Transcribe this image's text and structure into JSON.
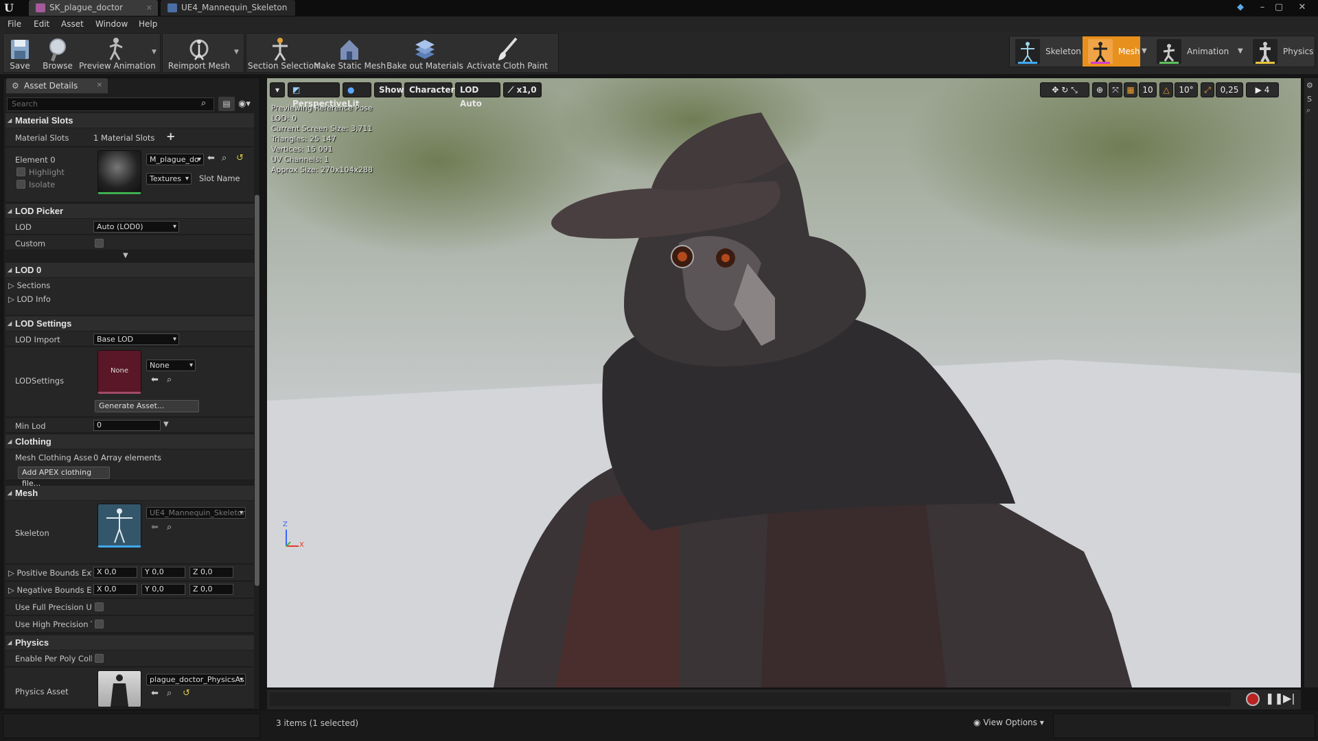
{
  "titlebar": {
    "tabs": [
      {
        "label": "SK_plague_doctor"
      },
      {
        "label": "UE4_Mannequin_Skeleton"
      }
    ],
    "minimize": "–",
    "maximize": "▢",
    "close": "✕"
  },
  "menu": [
    "File",
    "Edit",
    "Asset",
    "Window",
    "Help"
  ],
  "toolbar": {
    "save": "Save",
    "browse": "Browse",
    "preview_animation": "Preview Animation",
    "reimport_mesh": "Reimport Mesh",
    "section_selection": "Section Selection",
    "make_static_mesh": "Make Static Mesh",
    "bake_out_materials": "Bake out Materials",
    "activate_cloth_paint": "Activate Cloth Paint"
  },
  "modes": {
    "skeleton": "Skeleton",
    "mesh": "Mesh",
    "animation": "Animation",
    "physics": "Physics",
    "active": "Mesh",
    "active_color": "#e8901e"
  },
  "details": {
    "tab": "Asset Details",
    "search_placeholder": "Search",
    "material_slots": {
      "header": "Material Slots",
      "label": "Material Slots",
      "count": "1 Material Slots",
      "element": "Element 0",
      "highlight": "Highlight",
      "isolate": "Isolate",
      "material": "M_plague_do",
      "textures": "Textures",
      "slot_name": "Slot Name"
    },
    "lod_picker": {
      "header": "LOD Picker",
      "lod_label": "LOD",
      "lod_value": "Auto (LOD0)",
      "custom": "Custom"
    },
    "lod0": {
      "header": "LOD 0",
      "sections": "Sections",
      "lod_info": "LOD Info"
    },
    "lod_settings": {
      "header": "LOD Settings",
      "lod_import": "LOD Import",
      "lod_import_value": "Base LOD",
      "lodsettings": "LODSettings",
      "thumb_none": "None",
      "none_combo": "None",
      "generate": "Generate Asset...",
      "min_lod": "Min Lod",
      "min_lod_value": "0"
    },
    "clothing": {
      "header": "Clothing",
      "label": "Mesh Clothing Asset",
      "value": "0 Array elements",
      "add_btn": "Add APEX clothing file..."
    },
    "mesh": {
      "header": "Mesh",
      "skeleton": "Skeleton",
      "skeleton_value": "UE4_Mannequin_Skeleton",
      "pos_bounds": "Positive Bounds Exte",
      "neg_bounds": "Negative Bounds Exte",
      "x": "X",
      "y": "Y",
      "z": "Z",
      "zero": "0,0",
      "full_uv": "Use Full Precision UV",
      "high_tan": "Use High Precision Ta"
    },
    "physics": {
      "header": "Physics",
      "per_poly": "Enable Per Poly Collis",
      "physics_asset": "Physics Asset",
      "physics_asset_value": "plague_doctor_PhysicsAs"
    }
  },
  "viewport": {
    "perspective": "Perspective",
    "lit": "Lit",
    "show": "Show",
    "character": "Character",
    "lod_auto": "LOD Auto",
    "speed": "x1,0",
    "stats": [
      "Previewing Reference Pose",
      "LOD: 0",
      "Current Screen Size: 3,711",
      "Triangles: 25 147",
      "Vertices: 15 091",
      "UV Channels: 1",
      "Approx Size: 270x104x288"
    ],
    "grid_snap": "10",
    "rot_snap": "10°",
    "scale_snap": "0,25",
    "cam_speed": "4",
    "axis_z": "Z",
    "axis_x": "X"
  },
  "status": {
    "items": "3 items (1 selected)",
    "view_options": "View Options"
  }
}
